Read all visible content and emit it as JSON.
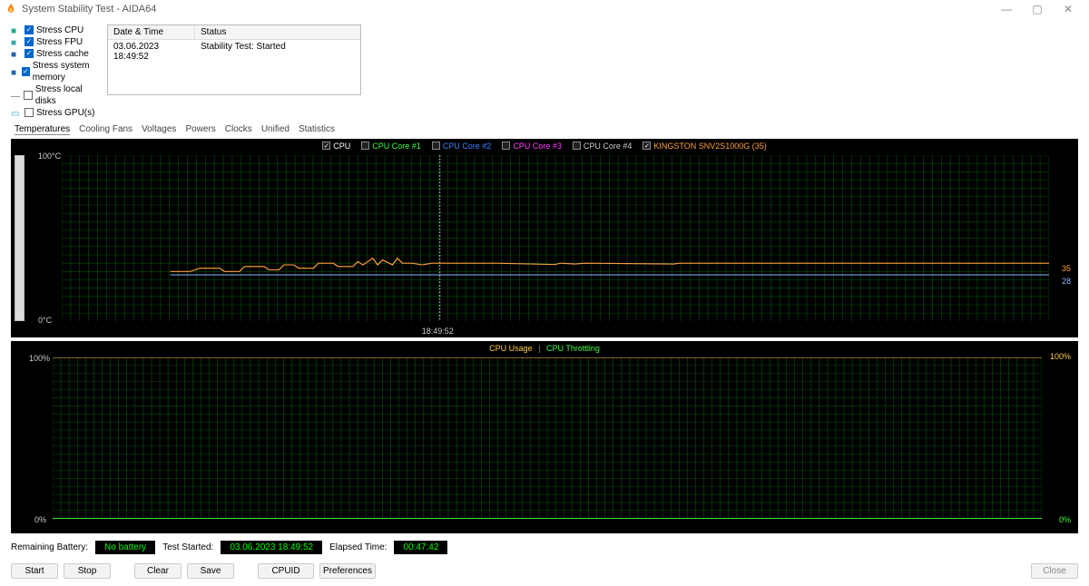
{
  "window": {
    "title": "System Stability Test - AIDA64"
  },
  "stress": {
    "items": [
      {
        "label": "Stress CPU",
        "checked": true,
        "icon": "cpu-icon",
        "color": "#2a8"
      },
      {
        "label": "Stress FPU",
        "checked": true,
        "icon": "fpu-icon",
        "color": "#3aa"
      },
      {
        "label": "Stress cache",
        "checked": true,
        "icon": "cache-icon",
        "color": "#26a"
      },
      {
        "label": "Stress system memory",
        "checked": true,
        "icon": "memory-icon",
        "color": "#26a"
      },
      {
        "label": "Stress local disks",
        "checked": false,
        "icon": "disk-icon",
        "color": "#666"
      },
      {
        "label": "Stress GPU(s)",
        "checked": false,
        "icon": "gpu-icon",
        "color": "#29c"
      }
    ]
  },
  "log": {
    "header_date": "Date & Time",
    "header_status": "Status",
    "row_date": "03.06.2023 18:49:52",
    "row_status": "Stability Test: Started"
  },
  "tabs": {
    "items": [
      "Temperatures",
      "Cooling Fans",
      "Voltages",
      "Powers",
      "Clocks",
      "Unified",
      "Statistics"
    ],
    "active": 0
  },
  "temp_legend": {
    "items": [
      {
        "label": "CPU",
        "checked": true,
        "color": "#ffffff"
      },
      {
        "label": "CPU Core #1",
        "checked": false,
        "color": "#40ff40"
      },
      {
        "label": "CPU Core #2",
        "checked": false,
        "color": "#4080ff"
      },
      {
        "label": "CPU Core #3",
        "checked": false,
        "color": "#ff40ff"
      },
      {
        "label": "CPU Core #4",
        "checked": false,
        "color": "#cccccc"
      },
      {
        "label": "KINGSTON SNV2S1000G (35)",
        "checked": true,
        "color": "#ffa040"
      }
    ]
  },
  "chart_data": [
    {
      "type": "line",
      "title": "Temperatures",
      "ylabel": "°C",
      "ylim": [
        0,
        100
      ],
      "y_top_label": "100°C",
      "y_bot_label": "0°C",
      "right_labels": [
        {
          "value": "35",
          "y_frac": 0.35,
          "color": "#ffa040"
        },
        {
          "value": "28",
          "y_frac": 0.28,
          "color": "#88b4ff"
        }
      ],
      "x_marker": {
        "frac": 0.383,
        "label": "18:49:52"
      },
      "series": [
        {
          "name": "KINGSTON SNV2S1000G",
          "color": "#ffa040",
          "points_frac": [
            [
              0.11,
              0.3
            ],
            [
              0.13,
              0.3
            ],
            [
              0.14,
              0.32
            ],
            [
              0.16,
              0.32
            ],
            [
              0.165,
              0.3
            ],
            [
              0.18,
              0.3
            ],
            [
              0.185,
              0.33
            ],
            [
              0.205,
              0.33
            ],
            [
              0.21,
              0.31
            ],
            [
              0.22,
              0.31
            ],
            [
              0.225,
              0.34
            ],
            [
              0.235,
              0.34
            ],
            [
              0.24,
              0.32
            ],
            [
              0.255,
              0.32
            ],
            [
              0.26,
              0.35
            ],
            [
              0.275,
              0.35
            ],
            [
              0.28,
              0.33
            ],
            [
              0.295,
              0.33
            ],
            [
              0.3,
              0.36
            ],
            [
              0.305,
              0.34
            ],
            [
              0.315,
              0.38
            ],
            [
              0.32,
              0.34
            ],
            [
              0.325,
              0.37
            ],
            [
              0.335,
              0.34
            ],
            [
              0.34,
              0.38
            ],
            [
              0.345,
              0.35
            ],
            [
              0.355,
              0.35
            ],
            [
              0.365,
              0.34
            ],
            [
              0.375,
              0.35
            ],
            [
              0.385,
              0.35
            ],
            [
              0.44,
              0.35
            ],
            [
              0.5,
              0.342
            ],
            [
              0.505,
              0.35
            ],
            [
              0.52,
              0.345
            ],
            [
              0.53,
              0.35
            ],
            [
              0.62,
              0.345
            ],
            [
              0.625,
              0.35
            ],
            [
              0.7,
              0.35
            ],
            [
              1.0,
              0.35
            ]
          ]
        },
        {
          "name": "CPU",
          "color": "#88b4ff",
          "points_frac": [
            [
              0.11,
              0.28
            ],
            [
              1.0,
              0.28
            ]
          ]
        }
      ]
    },
    {
      "type": "line",
      "title": "CPU Usage / Throttling",
      "ylabel": "%",
      "ylim": [
        0,
        100
      ],
      "y_top_label": "100%",
      "y_bot_label": "0%",
      "right_labels": [
        {
          "value": "100%",
          "y_frac": 1.0,
          "color": "#ffcc44"
        },
        {
          "value": "0%",
          "y_frac": 0.0,
          "color": "#44ff44"
        }
      ],
      "series": [
        {
          "name": "CPU Usage",
          "color": "#ffcc44",
          "points_frac": [
            [
              0.0,
              1.0
            ],
            [
              1.0,
              1.0
            ]
          ]
        },
        {
          "name": "CPU Throttling",
          "color": "#44ff44",
          "points_frac": [
            [
              0.0,
              0.0
            ],
            [
              1.0,
              0.0
            ]
          ]
        }
      ]
    }
  ],
  "throttle": {
    "usage_label": "CPU Usage",
    "sep": "|",
    "throttle_label": "CPU Throttling"
  },
  "status": {
    "battery_label": "Remaining Battery:",
    "battery_value": "No battery",
    "started_label": "Test Started:",
    "started_value": "03.06.2023 18:49:52",
    "elapsed_label": "Elapsed Time:",
    "elapsed_value": "00:47:42"
  },
  "buttons": {
    "start": "Start",
    "stop": "Stop",
    "clear": "Clear",
    "save": "Save",
    "cpuid": "CPUID",
    "prefs": "Preferences",
    "close": "Close"
  }
}
